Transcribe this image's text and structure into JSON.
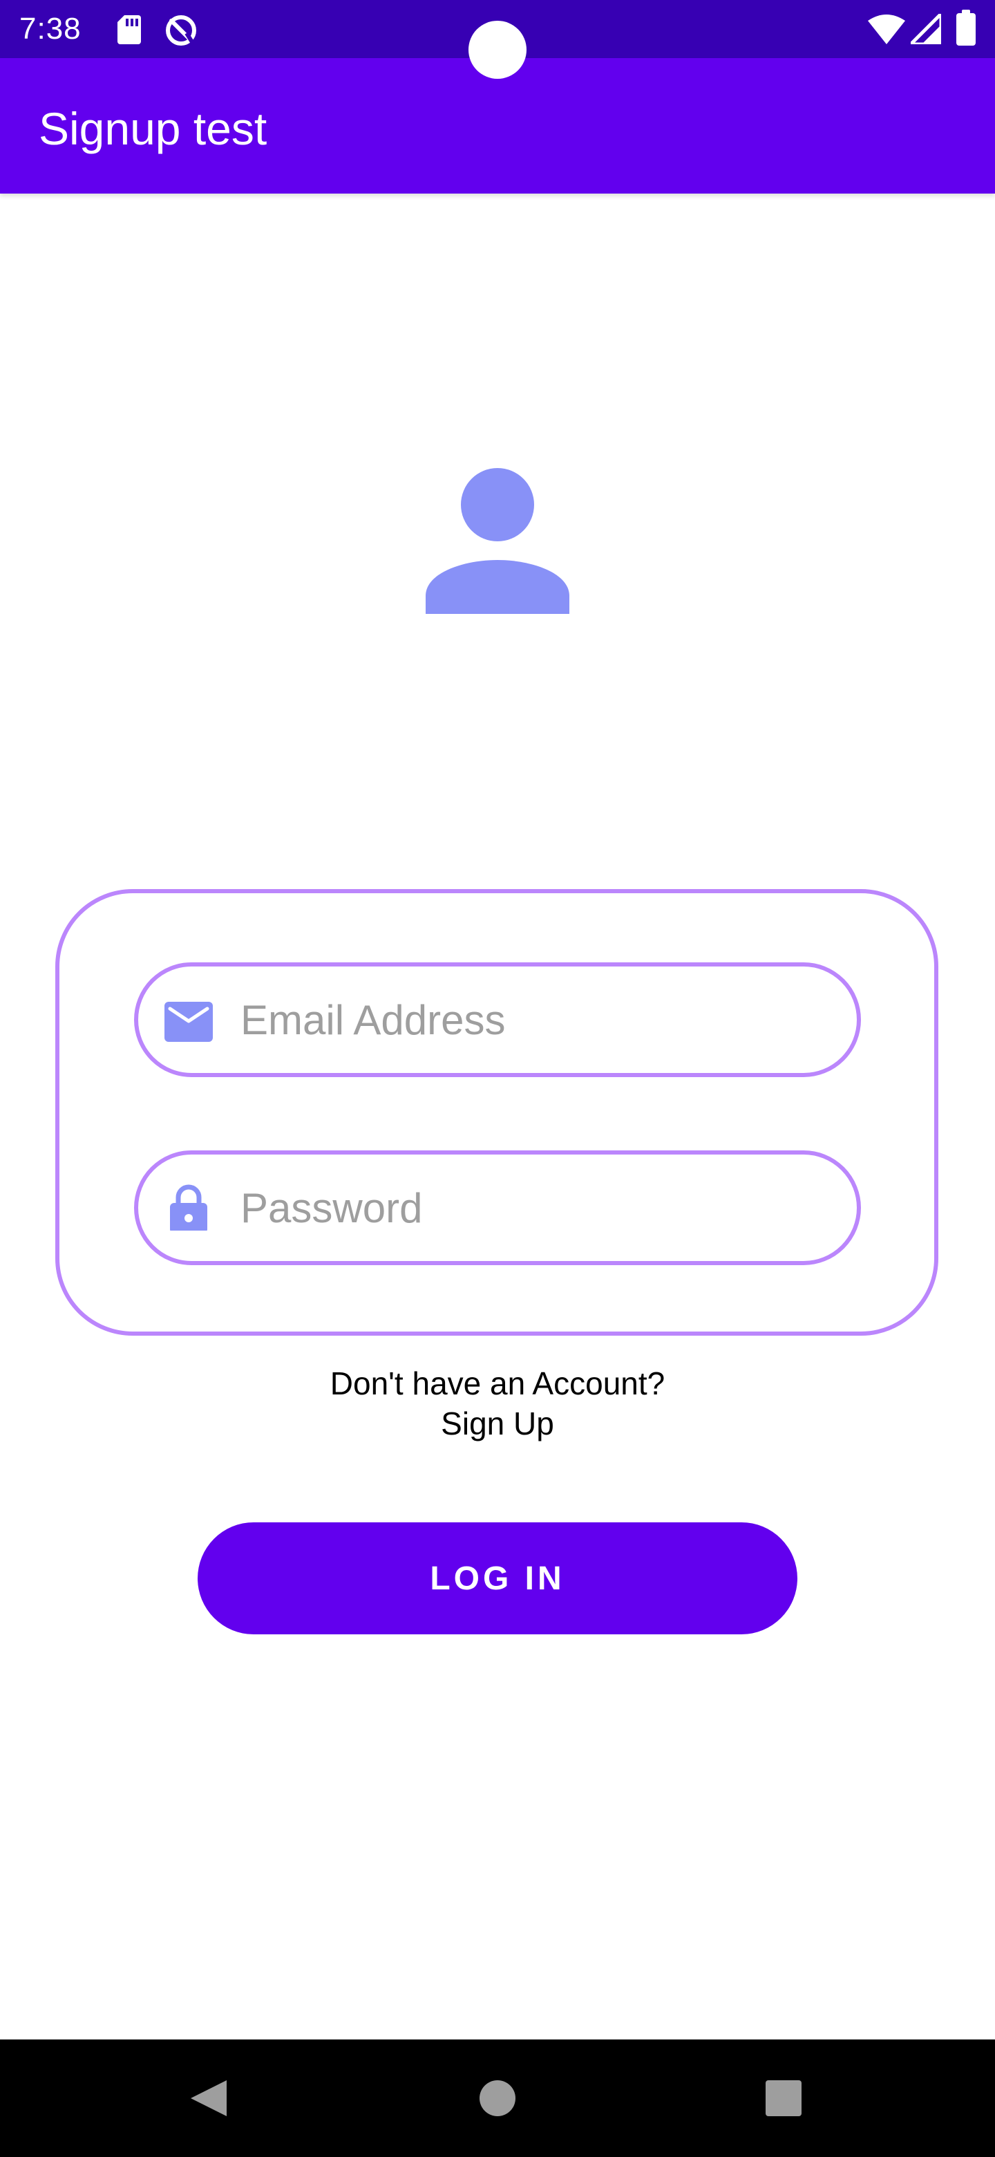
{
  "status_bar": {
    "time": "7:38",
    "left_icons": [
      "sd-card-icon",
      "data-saver-icon"
    ],
    "right_icons": [
      "wifi-icon",
      "signal-icon",
      "battery-icon"
    ]
  },
  "app_bar": {
    "title": "Signup test"
  },
  "avatar": {
    "icon": "person-icon"
  },
  "form": {
    "email": {
      "placeholder": "Email Address",
      "value": "",
      "icon": "email-icon"
    },
    "password": {
      "placeholder": "Password",
      "value": "",
      "icon": "lock-icon"
    }
  },
  "signup_prompt": {
    "line1": "Don't have an Account?",
    "line2": "Sign Up"
  },
  "login_button": {
    "label": "LOG IN"
  },
  "nav_bar": {
    "buttons": [
      "back-icon",
      "home-icon",
      "recents-icon"
    ]
  },
  "colors": {
    "status_bar": "#3700b3",
    "primary": "#6200ee",
    "outline": "#bb86fc",
    "icon_tint": "#8891f7",
    "placeholder": "#9e9e9e",
    "nav_bar": "#000000",
    "nav_icon": "#9e9e9e"
  }
}
